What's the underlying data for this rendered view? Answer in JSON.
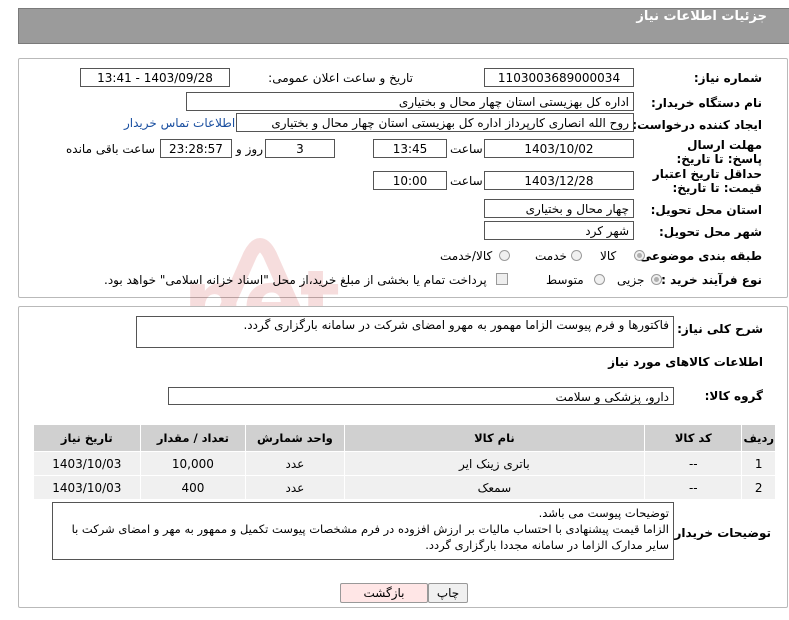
{
  "header": {
    "title": "جزئیات اطلاعات نیاز"
  },
  "fields": {
    "need_number_label": "شماره نیاز:",
    "need_number": "1103003689000034",
    "announce_label": "تاریخ و ساعت اعلان عمومی:",
    "announce_value": "1403/09/28 - 13:41",
    "buyer_org_label": "نام دستگاه خریدار:",
    "buyer_org": "اداره کل بهزیستی استان چهار محال و بختیاری",
    "requester_label": "ایجاد کننده درخواست:",
    "requester": "روح الله انصاری کارپرداز اداره کل بهزیستی استان چهار محال و بختیاری",
    "contact_link": "اطلاعات تماس خریدار",
    "deadline_label": "مهلت ارسال پاسخ: تا تاریخ:",
    "deadline_date": "1403/10/02",
    "time_label": "ساعت",
    "deadline_time": "13:45",
    "days": "3",
    "days_label": "روز و",
    "remaining_time": "23:28:57",
    "remaining_label": "ساعت باقی مانده",
    "validity_label": "حداقل تاریخ اعتبار قیمت: تا تاریخ:",
    "validity_date": "1403/12/28",
    "validity_time": "10:00",
    "province_label": "استان محل تحویل:",
    "province": "چهار محال و بختیاری",
    "city_label": "شهر محل تحویل:",
    "city": "شهر کرد",
    "category_label": "طبقه بندی موضوعی:",
    "category_options": [
      "کالا",
      "خدمت",
      "کالا/خدمت"
    ],
    "process_label": "نوع فرآیند خرید :",
    "process_options": [
      "جزیی",
      "متوسط"
    ],
    "payment_note": "پرداخت تمام یا بخشی از مبلغ خرید،از محل \"اسناد خزانه اسلامی\" خواهد بود."
  },
  "description": {
    "label": "شرح کلی نیاز:",
    "text": "فاکتورها و فرم پیوست الزاما مهمور به مهرو امضای شرکت در سامانه بارگزاری گردد."
  },
  "goods": {
    "section_title": "اطلاعات کالاهای مورد نیاز",
    "group_label": "گروه کالا:",
    "group_value": "دارو، پزشکی و سلامت",
    "columns": [
      "ردیف",
      "کد کالا",
      "نام کالا",
      "واحد شمارش",
      "تعداد / مقدار",
      "تاریخ نیاز"
    ],
    "rows": [
      {
        "row": "1",
        "code": "--",
        "name": "باتری زینک ایر",
        "unit": "عدد",
        "qty": "10,000",
        "date": "1403/10/03"
      },
      {
        "row": "2",
        "code": "--",
        "name": "سمعک",
        "unit": "عدد",
        "qty": "400",
        "date": "1403/10/03"
      }
    ]
  },
  "buyer_notes": {
    "label": "توضیحات خریدار:",
    "lines": [
      "توضیحات پیوست می باشد.",
      "الزاما قیمت پیشنهادی با احتساب مالیات بر ارزش افزوده در فرم مشخصات پیوست تکمیل و ممهور به مهر و امضای شرکت با",
      "سایر مدارک الزاما در سامانه مجددا بارگزاری گردد."
    ]
  },
  "buttons": {
    "back": "بازگشت",
    "print": "چاپ"
  },
  "watermark": {
    "text": "AriaTender.net"
  },
  "colors": {
    "header_bg": "#9b9b9b",
    "back_btn_bg": "#ffe6e6",
    "print_btn_bg": "#f0f0f0",
    "link": "#1a4fa0"
  }
}
